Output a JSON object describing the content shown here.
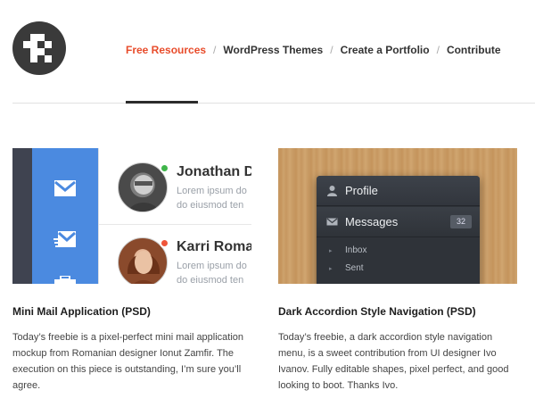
{
  "nav": {
    "items": [
      {
        "label": "Free Resources",
        "active": true
      },
      {
        "label": "WordPress Themes",
        "active": false
      },
      {
        "label": "Create a Portfolio",
        "active": false
      },
      {
        "label": "Contribute",
        "active": false
      }
    ],
    "separator": "/"
  },
  "colors": {
    "accent": "#e84c2b",
    "mail_blue": "#4b8ae0",
    "online": "#3fb54a",
    "busy": "#f0553a"
  },
  "cards": [
    {
      "title": "Mini Mail Application (PSD)",
      "description": "Today’s freebie is a pixel-perfect mini mail application mockup from Romanian designer Ionut Zamfir. The execution on this piece is outstanding, I’m sure you’ll agree.",
      "preview": {
        "contacts": [
          {
            "name": "Jonathan D",
            "line1": "Lorem ipsum do",
            "line2": "do eiusmod ten",
            "status": "online"
          },
          {
            "name": "Karri Roman",
            "line1": "Lorem ipsum do",
            "line2": "do eiusmod ten",
            "status": "busy"
          }
        ],
        "icons": [
          "mail-icon",
          "mail-fast-icon",
          "briefcase-icon"
        ]
      }
    },
    {
      "title": "Dark Accordion Style Navigation (PSD)",
      "description": "Today’s freebie, a dark accordion style navigation menu, is a sweet contribution from UI designer Ivo Ivanov. Fully editable shapes, pixel perfect, and good looking to boot. Thanks Ivo.",
      "preview": {
        "profile_label": "Profile",
        "messages_label": "Messages",
        "messages_count": "32",
        "sub_items": [
          "Inbox",
          "Sent"
        ]
      }
    }
  ]
}
